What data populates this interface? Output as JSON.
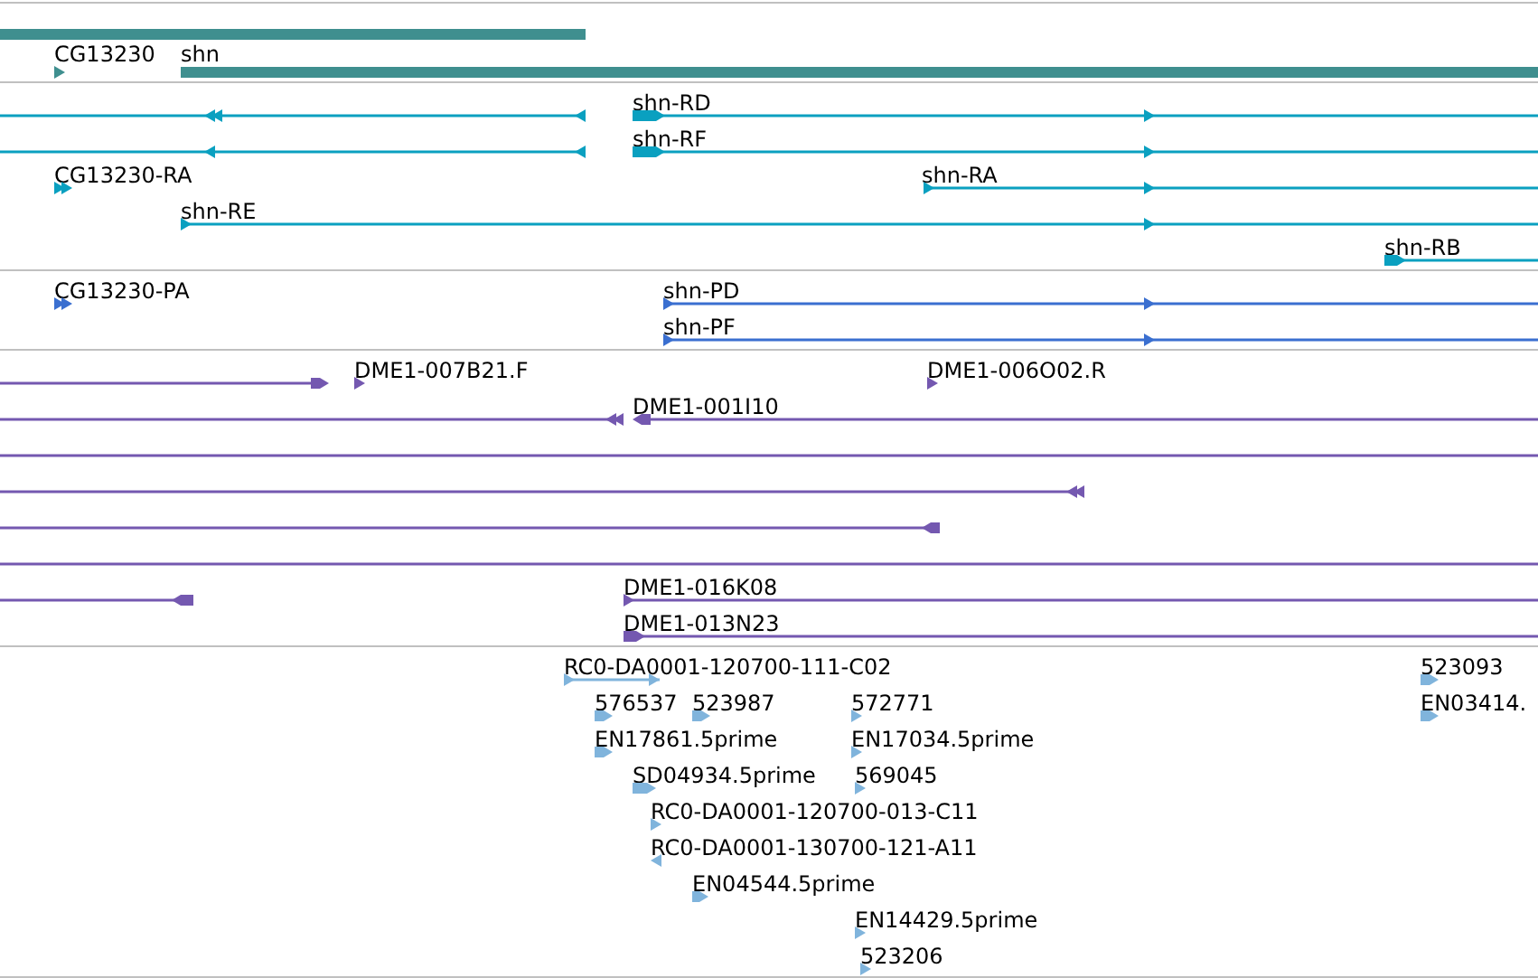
{
  "tracks": [
    {
      "color": "#3f8f8f",
      "features": [
        {
          "kind": "bar"
        },
        {
          "kind": "arrow",
          "label": "CG13230"
        },
        {
          "kind": "bar",
          "label": "shn"
        }
      ]
    },
    {
      "color": "#0aa0c0",
      "features": [
        {
          "kind": "line"
        },
        {
          "kind": "line",
          "label": "shn-RD"
        },
        {
          "kind": "line"
        },
        {
          "kind": "line",
          "label": "shn-RF"
        },
        {
          "kind": "arrow",
          "label": "CG13230-RA"
        },
        {
          "kind": "line",
          "label": "shn-RA"
        },
        {
          "kind": "line",
          "label": "shn-RE"
        },
        {
          "kind": "line",
          "label": "shn-RB"
        }
      ]
    },
    {
      "color": "#3a6fd0",
      "features": [
        {
          "kind": "arrow",
          "label": "CG13230-PA"
        },
        {
          "kind": "line",
          "label": "shn-PD"
        },
        {
          "kind": "line",
          "label": "shn-PF"
        }
      ]
    },
    {
      "color": "#7458b0",
      "features": [
        {
          "kind": "line"
        },
        {
          "kind": "arrow",
          "label": "DME1-007B21.F"
        },
        {
          "kind": "arrow",
          "label": "DME1-006O02.R"
        },
        {
          "kind": "line"
        },
        {
          "kind": "line",
          "label": "DME1-001I10"
        },
        {
          "kind": "line"
        },
        {
          "kind": "line"
        },
        {
          "kind": "line"
        },
        {
          "kind": "line"
        },
        {
          "kind": "line"
        },
        {
          "kind": "line",
          "label": "DME1-016K08"
        },
        {
          "kind": "line",
          "label": "DME1-013N23"
        }
      ]
    },
    {
      "color": "#80b4dc",
      "features": [
        {
          "kind": "line",
          "label": "RC0-DA0001-120700-111-C02"
        },
        {
          "kind": "arrow",
          "label": "523093"
        },
        {
          "kind": "arrow",
          "label": "576537"
        },
        {
          "kind": "arrow",
          "label": "523987"
        },
        {
          "kind": "arrow",
          "label": "572771"
        },
        {
          "kind": "arrow",
          "label": "EN03414."
        },
        {
          "kind": "arrow",
          "label": "EN17861.5prime"
        },
        {
          "kind": "arrow",
          "label": "EN17034.5prime"
        },
        {
          "kind": "arrow",
          "label": "SD04934.5prime"
        },
        {
          "kind": "arrow",
          "label": "569045"
        },
        {
          "kind": "arrow",
          "label": "RC0-DA0001-120700-013-C11"
        },
        {
          "kind": "arrow",
          "label": "RC0-DA0001-130700-121-A11"
        },
        {
          "kind": "arrow",
          "label": "EN04544.5prime"
        },
        {
          "kind": "arrow",
          "label": "EN14429.5prime"
        },
        {
          "kind": "arrow",
          "label": "523206"
        }
      ]
    }
  ]
}
